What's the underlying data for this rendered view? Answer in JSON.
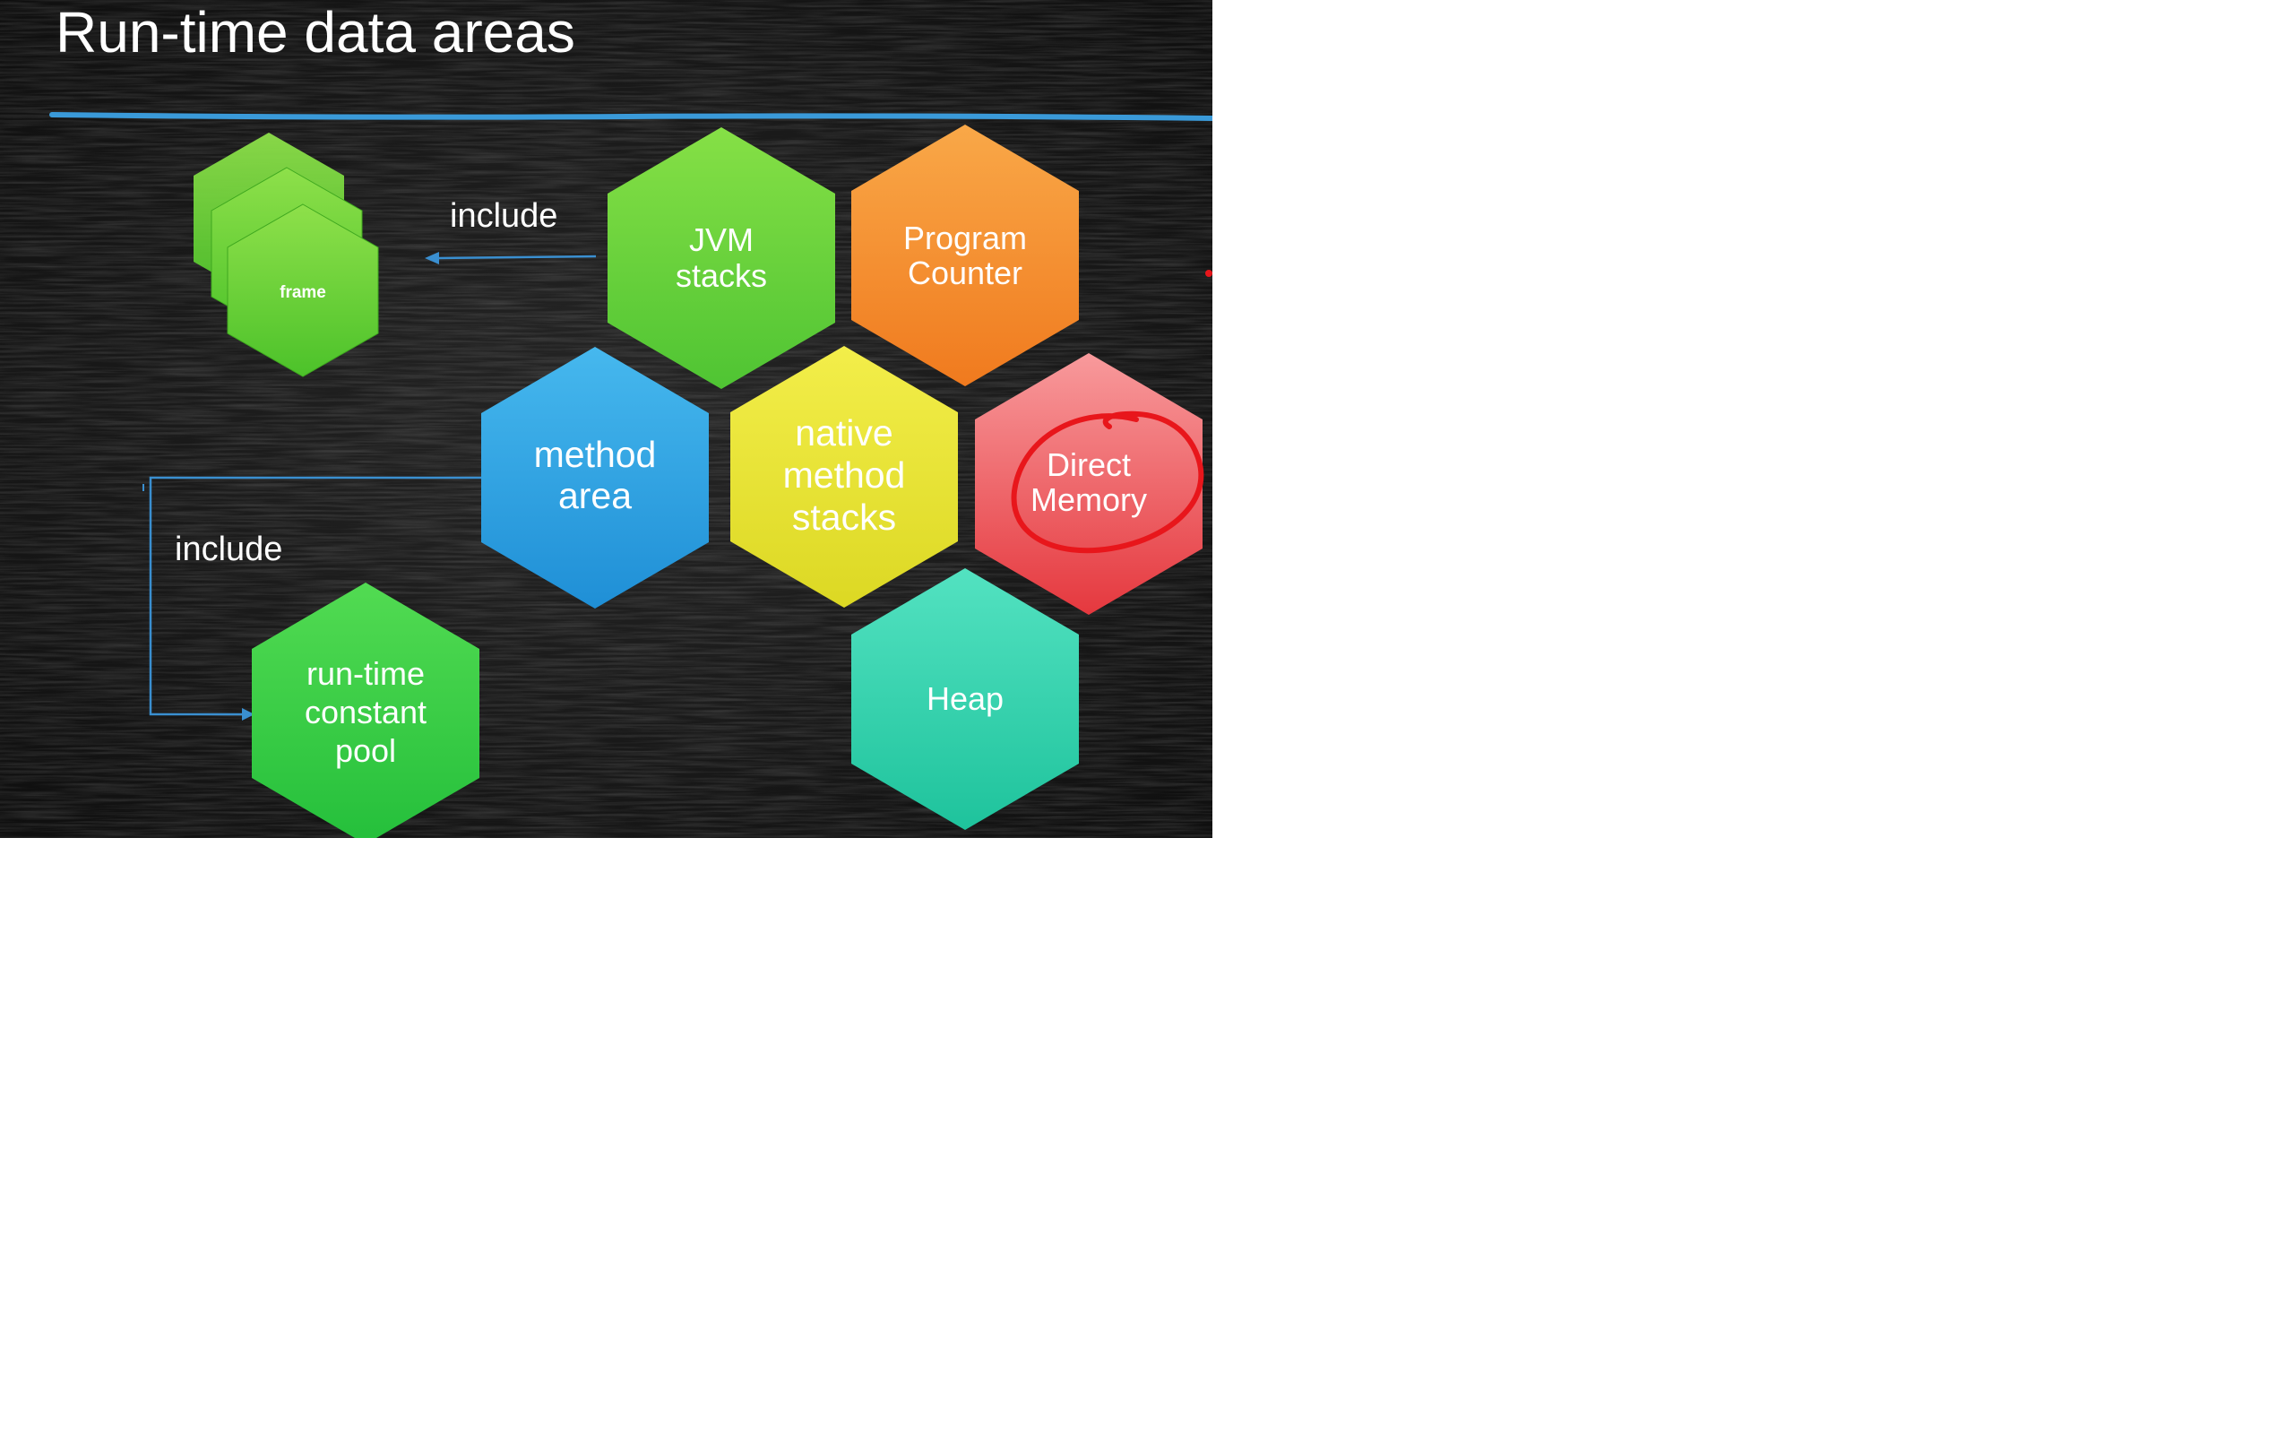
{
  "slide": {
    "title": "Run-time data areas",
    "background_color": "#141414",
    "rule_color": "#3a9ad9",
    "connector_color": "#3a8fd0",
    "annotation_color": "#e8161b"
  },
  "hexagons": {
    "frame": {
      "label": "frame",
      "color_top": "#8ee04a",
      "color_bottom": "#4cc22a"
    },
    "jvm_stacks": {
      "label_lines": [
        "JVM",
        "stacks"
      ],
      "color_top": "#86e046",
      "color_bottom": "#4fc433"
    },
    "program_counter": {
      "label_lines": [
        "Program",
        "Counter"
      ],
      "color_top": "#f9a848",
      "color_bottom": "#f07a1e"
    },
    "method_area": {
      "label_lines": [
        "method",
        "area"
      ],
      "color_top": "#46b8ee",
      "color_bottom": "#1f8fd6"
    },
    "native_method_stacks": {
      "label_lines": [
        "native",
        "method",
        "stacks"
      ],
      "color_top": "#f3ee4a",
      "color_bottom": "#dcd823"
    },
    "direct_memory": {
      "label_lines": [
        "Direct",
        "Memory"
      ],
      "color_top": "#f89a9c",
      "color_bottom": "#e5383e"
    },
    "run_time_constant_pool": {
      "label_lines": [
        "run-time",
        "constant",
        "pool"
      ],
      "color_top": "#52db52",
      "color_bottom": "#24bf3b"
    },
    "heap": {
      "label_lines": [
        "Heap"
      ],
      "color_top": "#53e2c1",
      "color_bottom": "#1ec39c"
    }
  },
  "connectors": {
    "jvm_to_frame_label": "include",
    "method_to_pool_label": "include"
  },
  "icons": {
    "arrow": "arrowhead-icon",
    "circle": "hand-drawn-circle-annotation"
  }
}
